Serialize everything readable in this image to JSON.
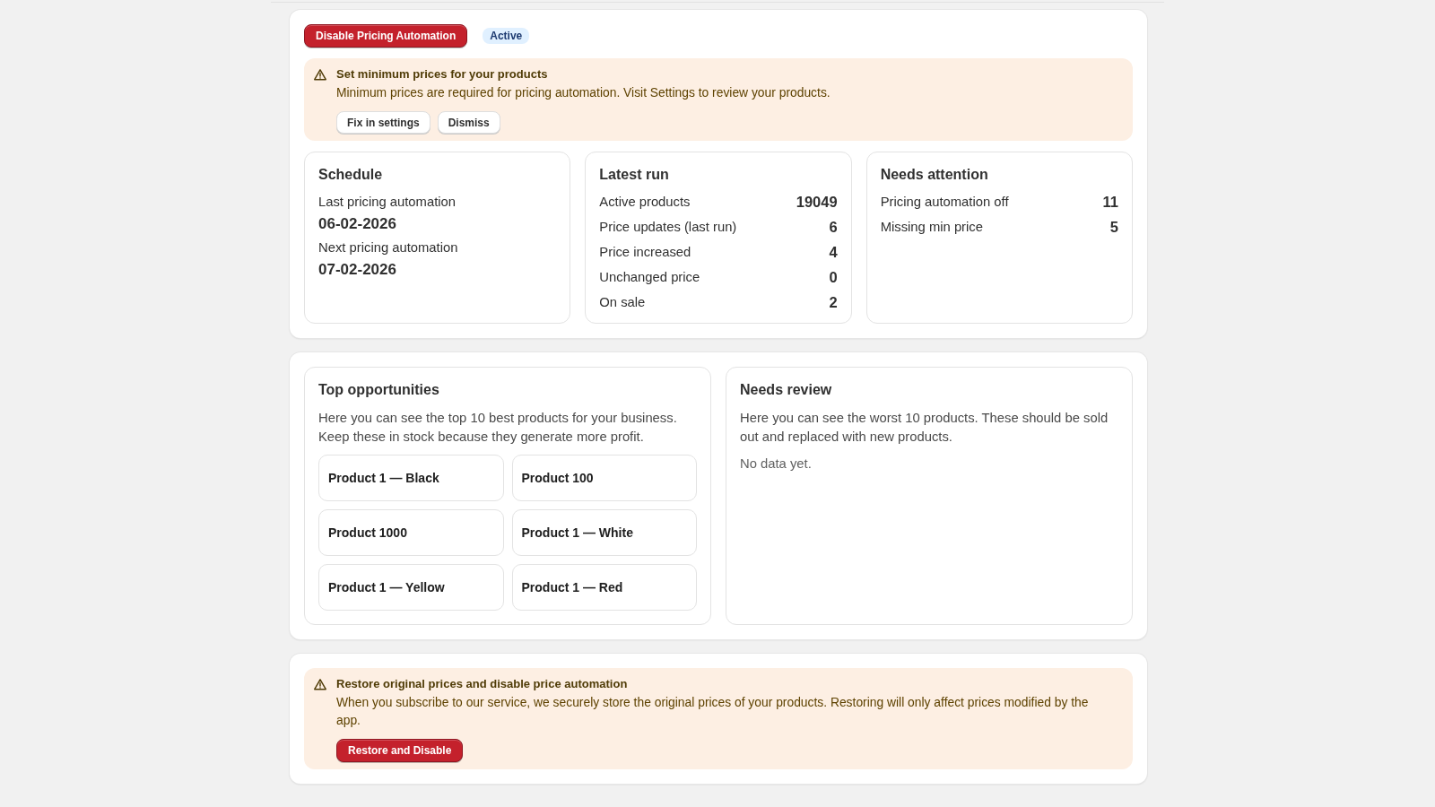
{
  "header": {
    "action": "Disable Pricing Automation",
    "status": "Active"
  },
  "setup_banner": {
    "title": "Set minimum prices for your products",
    "message": "Minimum prices are required for pricing automation. Visit Settings to review your products.",
    "actions": [
      {
        "label": "Fix in settings",
        "kind": "secondary"
      },
      {
        "label": "Dismiss",
        "kind": "secondary"
      }
    ]
  },
  "stat_cards": [
    {
      "kind": "schedule",
      "title": "Schedule",
      "items": [
        {
          "label": "Last pricing automation",
          "value": "06-02-2026"
        },
        {
          "label": "Next pricing automation",
          "value": "07-02-2026"
        }
      ]
    },
    {
      "kind": "metrics",
      "title": "Latest run",
      "items": [
        {
          "label": "Active products",
          "value": "19049"
        },
        {
          "label": "Price updates (last run)",
          "value": "6"
        },
        {
          "label": "Price increased",
          "value": "4"
        },
        {
          "label": "Unchanged price",
          "value": "0"
        },
        {
          "label": "On sale",
          "value": "2"
        }
      ]
    },
    {
      "kind": "metrics",
      "title": "Needs attention",
      "items": [
        {
          "label": "Pricing automation off",
          "value": "11"
        },
        {
          "label": "Missing min price",
          "value": "5"
        }
      ]
    }
  ],
  "top_opportunities": {
    "title": "Top opportunities",
    "description": "Here you can see the top 10 best products for your business. Keep these in stock because they generate more profit.",
    "products": [
      "Product 1 — Black",
      "Product 100",
      "Product 1000",
      "Product 1 — White",
      "Product 1 — Yellow",
      "Product 1 — Red"
    ]
  },
  "needs_review": {
    "title": "Needs review",
    "description": "Here you can see the worst 10 products. These should be sold out and replaced with new products.",
    "empty_message": "No data yet."
  },
  "restore_banner": {
    "title": "Restore original prices and disable price automation",
    "message": "When you subscribe to our service, we securely store the original prices of your products. Restoring will only affect prices modified by the app.",
    "actions": [
      {
        "label": "Restore and Disable",
        "kind": "critical"
      }
    ]
  }
}
